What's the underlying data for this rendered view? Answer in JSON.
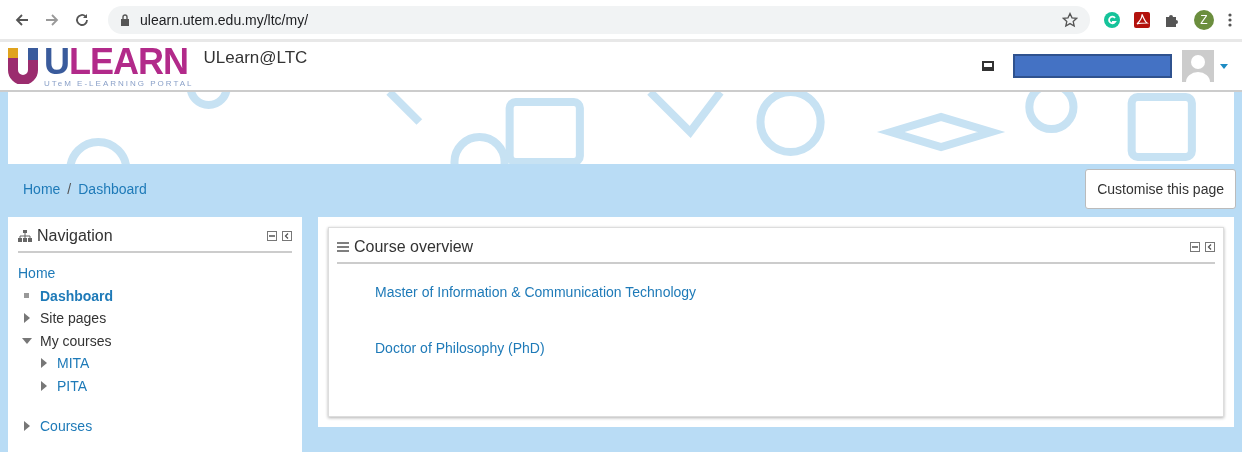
{
  "browser": {
    "url": "ulearn.utem.edu.my/ltc/my/",
    "profile_initial": "Z"
  },
  "header": {
    "logo_text": "ULEARN",
    "logo_tagline": "UTeM E-LEARNING PORTAL",
    "site_name": "ULearn@LTC"
  },
  "breadcrumb": [
    "Home",
    "Dashboard"
  ],
  "breadcrumb_separator": "/",
  "customise_button": "Customise this page",
  "navigation": {
    "title": "Navigation",
    "items": [
      {
        "label": "Home",
        "kind": "link"
      },
      {
        "label": "Dashboard",
        "kind": "current"
      },
      {
        "label": "Site pages",
        "kind": "branch",
        "linked": false,
        "expanded": false
      },
      {
        "label": "My courses",
        "kind": "branch",
        "linked": false,
        "expanded": true,
        "children": [
          {
            "label": "MITA",
            "kind": "branch",
            "linked": true,
            "expanded": false
          },
          {
            "label": "PITA",
            "kind": "branch",
            "linked": true,
            "expanded": false
          }
        ]
      },
      {
        "label": "Courses",
        "kind": "branch",
        "linked": true,
        "expanded": false,
        "gap": true
      }
    ]
  },
  "course_overview": {
    "title": "Course overview",
    "courses": [
      "Master of Information & Communication Technology",
      "Doctor of Philosophy (PhD)"
    ]
  }
}
